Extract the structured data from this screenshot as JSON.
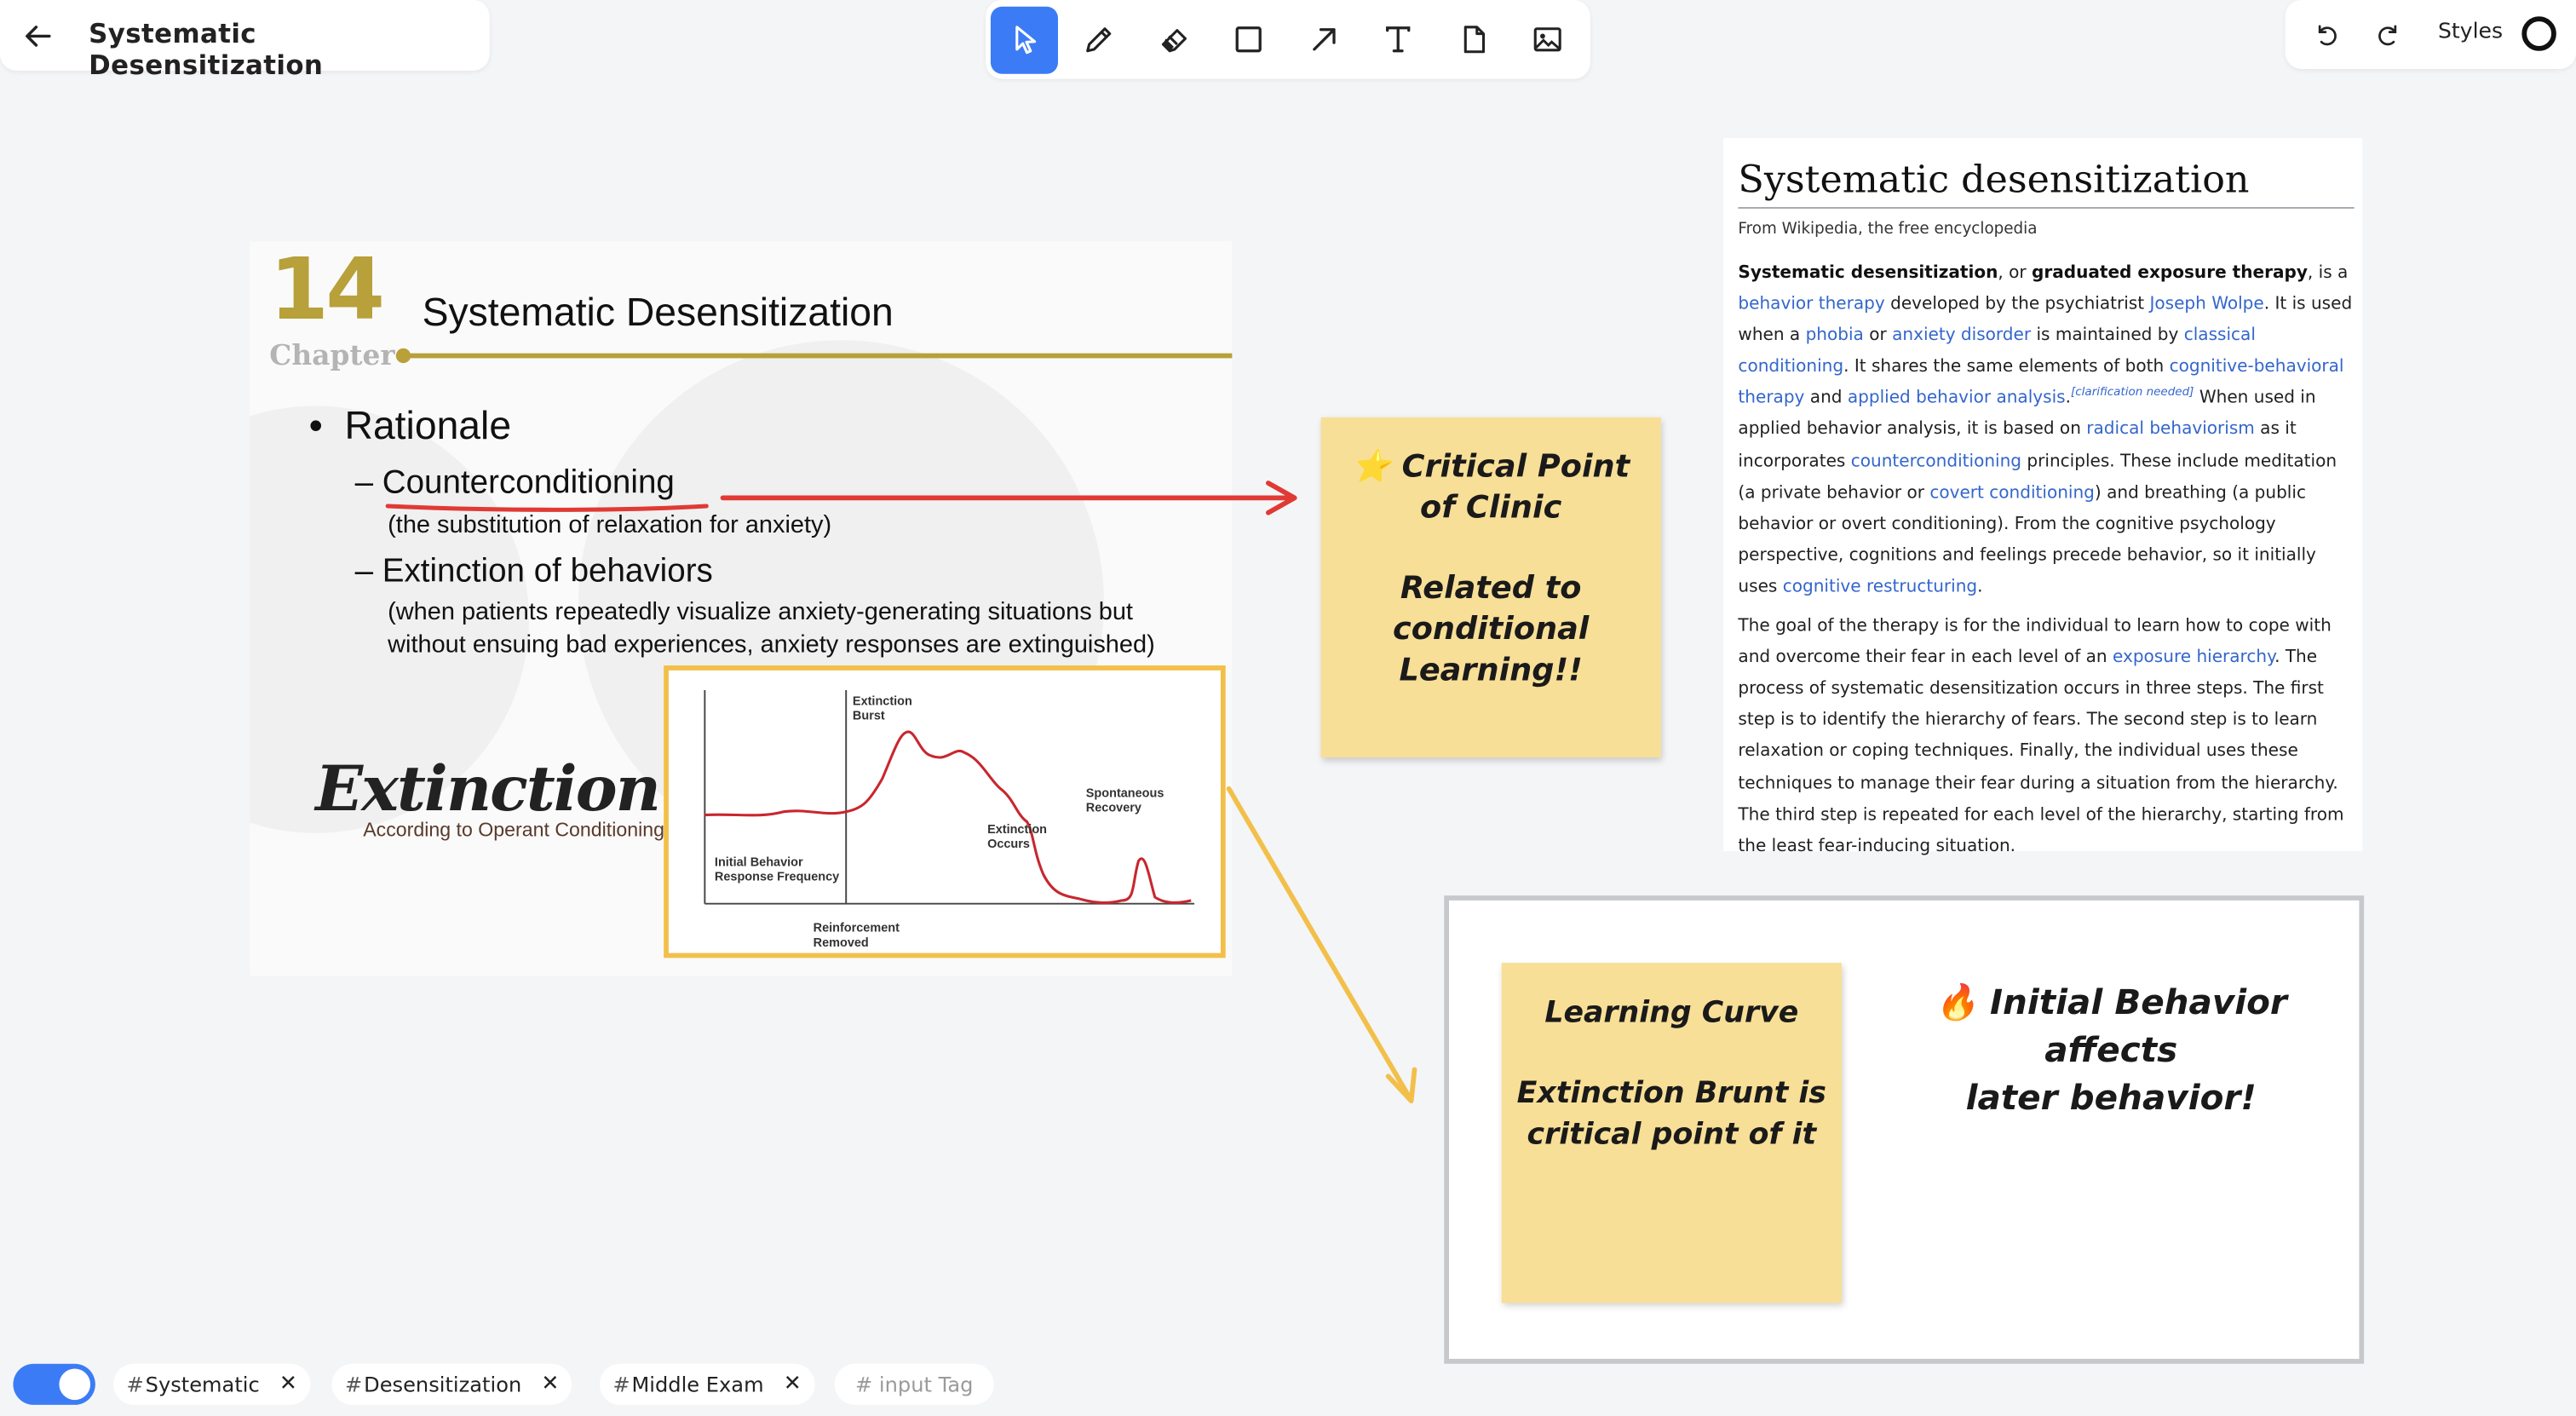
{
  "header": {
    "title": "Systematic Desensitization"
  },
  "toolbar": {
    "tools": [
      "select-tool",
      "pen-tool",
      "eraser-tool",
      "rectangle-tool",
      "arrow-tool",
      "text-tool",
      "note-tool",
      "image-tool"
    ],
    "active": "select-tool",
    "accent": "#3b7cf6"
  },
  "right_bar": {
    "styles_label": "Styles"
  },
  "slide": {
    "chapter_number": "14",
    "chapter_word": "Chapter",
    "title": "Systematic Desensitization",
    "bullet_rationale": "Rationale",
    "bullet_counter": "Counterconditioning",
    "counter_sub": "(the substitution of relaxation for anxiety)",
    "bullet_extinction": "Extinction of behaviors",
    "extinction_sub": "(when patients repeatedly visualize anxiety-generating situations but without ensuing bad experiences, anxiety responses are extinguished)",
    "extinction_logo": "Extinction",
    "extinction_logo_sub": "According to Operant Conditioning",
    "chart": {
      "label_burst": "Extinction\nBurst",
      "label_occurs": "Extinction\nOccurs",
      "label_recovery": "Spontaneous\nRecovery",
      "label_initial": "Initial Behavior\nResponse Frequency",
      "label_removed": "Reinforcement\nRemoved"
    }
  },
  "sticky_critical": {
    "line1a": "⭐ Critical Point",
    "line1b": "of Clinic",
    "line2a": "Related to",
    "line2b": "conditional",
    "line2c": "Learning!!"
  },
  "sticky_learning": {
    "line1": "Learning Curve",
    "line2a": "Extinction Brunt is",
    "line2b": "critical point of it"
  },
  "frame_text": {
    "line1": "🔥 Initial Behavior affects",
    "line2": "later behavior!"
  },
  "wiki": {
    "title": "Systematic desensitization",
    "from": "From Wikipedia, the free encyclopedia",
    "p1": {
      "t1": "Systematic desensitization",
      "t2": ", or ",
      "t3": "graduated exposure therapy",
      "t4": ", is a ",
      "l1": "behavior therapy",
      "t5": " developed by the psychiatrist ",
      "l2": "Joseph Wolpe",
      "t6": ". It is used when a ",
      "l3": "phobia",
      "t7": " or ",
      "l4": "anxiety disorder",
      "t8": " is maintained by ",
      "l5": "classical conditioning",
      "t9": ". It shares the same elements of both ",
      "l6": "cognitive-behavioral therapy",
      "t10": " and ",
      "l7": "applied behavior analysis",
      "t11": ".",
      "sup": "[clarification needed]",
      "t12": " When used in applied behavior analysis, it is based on ",
      "l8": "radical behaviorism",
      "t13": " as it incorporates ",
      "l9": "counterconditioning",
      "t14": " principles. These include meditation (a private behavior or ",
      "l10": "covert conditioning",
      "t15": ") and breathing (a public behavior or overt conditioning). From the cognitive psychology perspective, cognitions and feelings precede behavior, so it initially uses ",
      "l11": "cognitive restructuring",
      "t16": "."
    },
    "p2": {
      "t1": "The goal of the therapy is for the individual to learn how to cope with and overcome their fear in each level of an ",
      "l1": "exposure hierarchy",
      "t2": ". The process of systematic desensitization occurs in three steps. The first step is to identify the hierarchy of fears. The second step is to learn relaxation or coping techniques. Finally, the individual uses these techniques to manage their fear during a situation from the hierarchy. The third step is repeated for each level of the hierarchy, starting from the least fear-inducing situation."
    }
  },
  "tags": {
    "items": [
      "Systematic",
      "Desensitization",
      "Middle Exam"
    ],
    "hash": "#",
    "remove_glyph": "✕",
    "input_placeholder": "# input Tag"
  }
}
